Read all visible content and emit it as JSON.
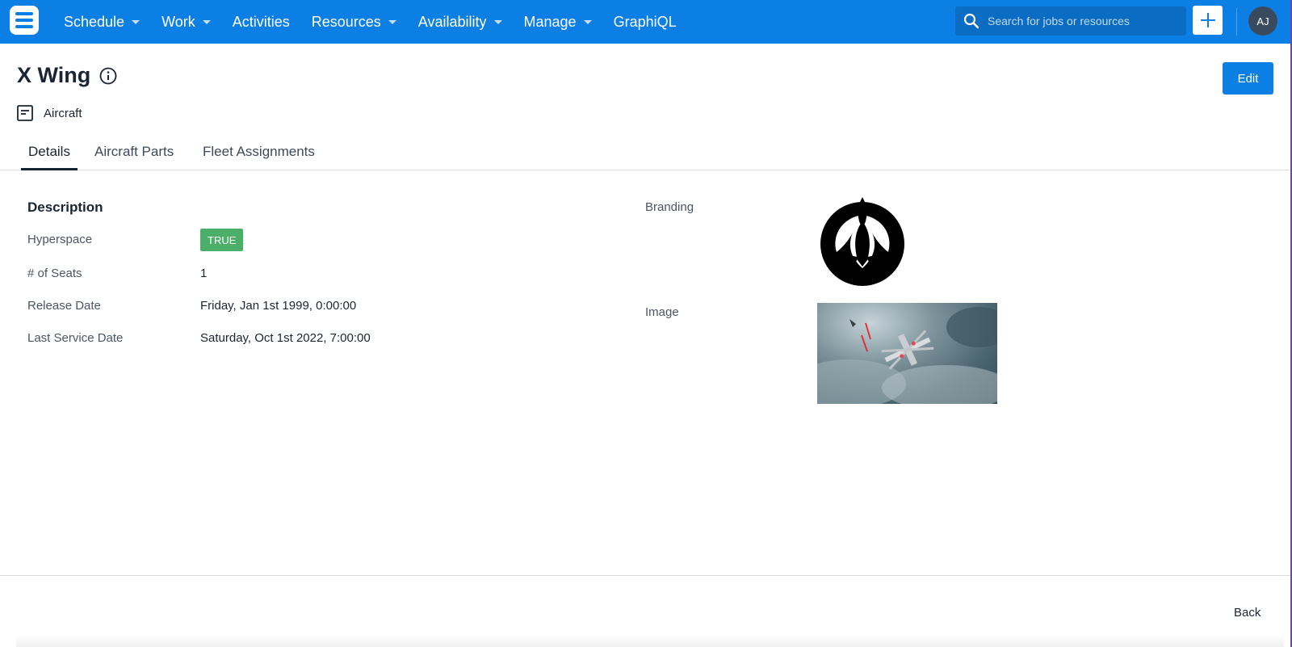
{
  "nav": {
    "items": [
      {
        "label": "Schedule",
        "has_caret": true
      },
      {
        "label": "Work",
        "has_caret": true
      },
      {
        "label": "Activities",
        "has_caret": false
      },
      {
        "label": "Resources",
        "has_caret": true
      },
      {
        "label": "Availability",
        "has_caret": true
      },
      {
        "label": "Manage",
        "has_caret": true
      },
      {
        "label": "GraphiQL",
        "has_caret": false
      }
    ],
    "search_placeholder": "Search for jobs or resources",
    "add_icon": "plus-icon",
    "avatar_initials": "AJ"
  },
  "header": {
    "title": "X Wing",
    "info_icon": "info-icon",
    "edit_label": "Edit",
    "type_icon": "document-icon",
    "type_label": "Aircraft"
  },
  "tabs": [
    {
      "label": "Details",
      "active": true
    },
    {
      "label": "Aircraft Parts",
      "active": false
    },
    {
      "label": "Fleet Assignments",
      "active": false
    }
  ],
  "details": {
    "section_title": "Description",
    "fields": [
      {
        "label": "Hyperspace",
        "value": "TRUE"
      },
      {
        "label": "# of Seats",
        "value": "1"
      },
      {
        "label": "Release Date",
        "value": "Friday, Jan 1st 1999, 0:00:00"
      },
      {
        "label": "Last Service Date",
        "value": "Saturday, Oct 1st 2022, 7:00:00"
      }
    ],
    "branding_label": "Branding",
    "image_label": "Image"
  },
  "footer": {
    "back_label": "Back"
  },
  "colors": {
    "brand": "#0b7fe3",
    "badge_green": "#4caf69",
    "text_dark": "#1a2533"
  }
}
